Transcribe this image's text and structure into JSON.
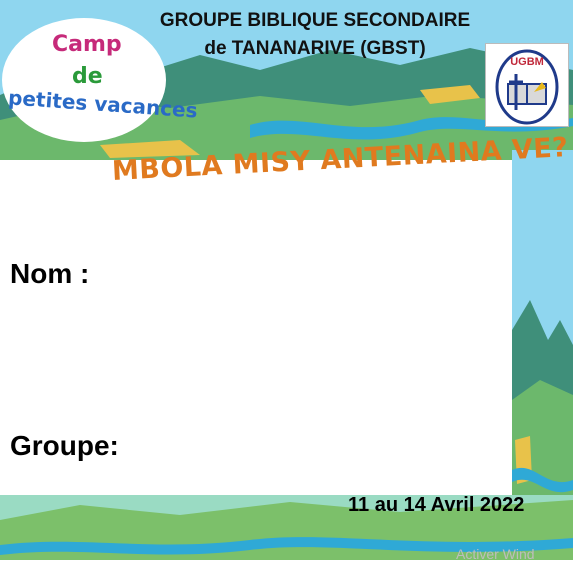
{
  "header": {
    "line1": "GROUPE BIBLIQUE SECONDAIRE",
    "line2": "de TANANARIVE (GBST)"
  },
  "camp_logo": {
    "word1": "Camp",
    "word2": "de",
    "word3": "petites vacances"
  },
  "org_logo": {
    "text": "UGBM"
  },
  "question": "MBOLA MISY ANTENAINA VE?",
  "form": {
    "nom_label": "Nom :",
    "groupe_label": "Groupe:"
  },
  "dates": "11 au 14 Avril 2022",
  "watermark": "Activer Wind",
  "colors": {
    "sky": "#7fd3ee",
    "mountain": "#3f8f7a",
    "hill": "#7cc06a",
    "river": "#2fa9d6",
    "question": "#e07a1f",
    "camp_title": "#c62a7a"
  }
}
